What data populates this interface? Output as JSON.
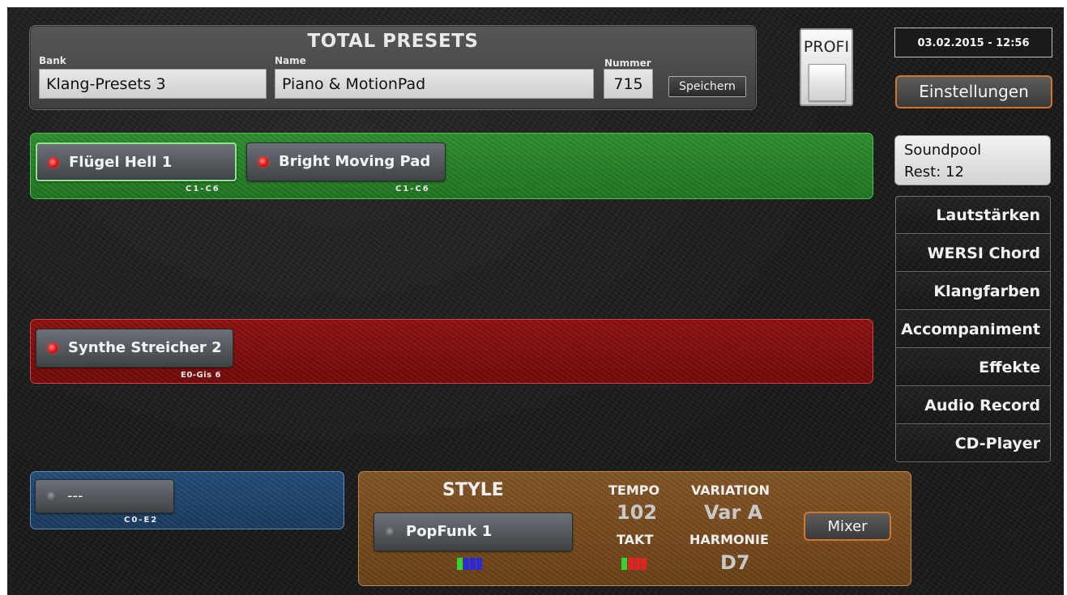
{
  "header": {
    "title": "TOTAL PRESETS",
    "bank_label": "Bank",
    "bank_value": "Klang-Presets 3",
    "name_label": "Name",
    "name_value": "Piano & MotionPad",
    "number_label": "Nummer",
    "number_value": "715",
    "save_label": "Speichern"
  },
  "profi_label": "PROFI",
  "datetime": "03.02.2015 - 12:56",
  "settings_label": "Einstellungen",
  "soundpool": {
    "line1": "Soundpool",
    "line2": "Rest: 12"
  },
  "menu": [
    "Lautstärken",
    "WERSI Chord",
    "Klangfarben",
    "Accompaniment",
    "Effekte",
    "Audio Record",
    "CD-Player"
  ],
  "upper": {
    "color": "#2f8f2f",
    "voices": [
      {
        "label": "Flügel Hell 1",
        "range": "C1-C6",
        "active": true,
        "selected": true
      },
      {
        "label": "Bright Moving Pad",
        "range": "C1-C6",
        "active": true,
        "selected": false
      }
    ]
  },
  "lower": {
    "color": "#8f1212",
    "voices": [
      {
        "label": "Synthe Streicher 2",
        "range": "E0-Gis 6",
        "active": true
      }
    ]
  },
  "bass": {
    "color": "#244d78",
    "voices": [
      {
        "label": "---",
        "range": "C0-E2",
        "active": false
      }
    ]
  },
  "style": {
    "title": "STYLE",
    "name": "PopFunk 1",
    "tempo_label": "TEMPO",
    "tempo_value": "102",
    "takt_label": "TAKT",
    "variation_label": "VARIATION",
    "variation_value": "Var A",
    "harmonie_label": "HARMONIE",
    "harmonie_value": "D7",
    "mixer_label": "Mixer",
    "style_meter_colors": [
      "#35d435",
      "#2a2ad8",
      "#2a2ad8",
      "#2a2ad8"
    ],
    "takt_meter_colors": [
      "#35d435",
      "#e02424",
      "#e02424",
      "#e02424"
    ]
  }
}
